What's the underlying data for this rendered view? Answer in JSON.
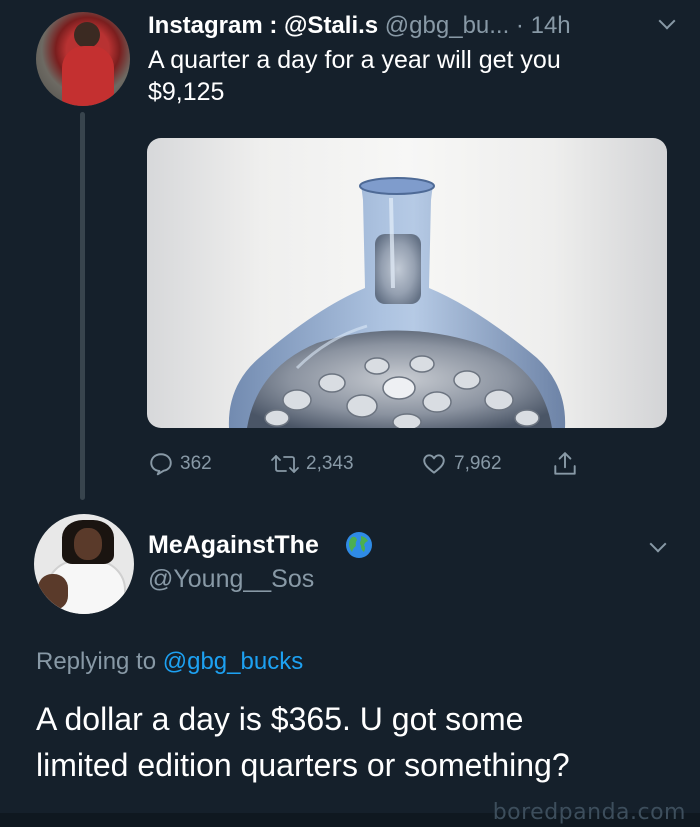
{
  "tweet": {
    "header_name": "Instagram : @Stali.s",
    "header_meta": " @gbg_bu... · 14h",
    "text": "A quarter a day for a year will get you\n$9,125",
    "actions": {
      "replies": "362",
      "retweets": "2,343",
      "likes": "7,962"
    }
  },
  "reply": {
    "display_name": "MeAgainstThe",
    "handle": "@Young__Sos",
    "replying_prefix": "Replying to ",
    "replying_mention": "@gbg_bucks",
    "text": "A dollar a day is $365. U got some\nlimited edition quarters or something?"
  },
  "watermark": "boredpanda.com",
  "icons": {
    "reply": "comment-bubble-icon",
    "retweet": "retweet-icon",
    "like": "heart-icon",
    "share": "share-icon",
    "menu": "chevron-down-icon",
    "name_emoji": "globe-emoji-icon"
  },
  "colors": {
    "background": "#15202b",
    "secondary_text": "#8899a6",
    "mention": "#1da1f2"
  }
}
